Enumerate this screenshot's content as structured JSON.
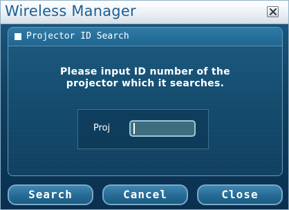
{
  "window": {
    "title": "Wireless Manager",
    "close_icon": "close-icon"
  },
  "panel": {
    "header_icon": "white-square-icon",
    "header_label": "Projector ID Search",
    "message_line1": "Please input ID number of the",
    "message_line2": "projector which it searches.",
    "proj_label": "Proj",
    "proj_value": ""
  },
  "buttons": {
    "search": "Search",
    "cancel": "Cancel",
    "close": "Close"
  },
  "colors": {
    "title_text": "#1c5f94",
    "background": "#0f4062",
    "button": "#266b95",
    "text": "#ffffff"
  }
}
